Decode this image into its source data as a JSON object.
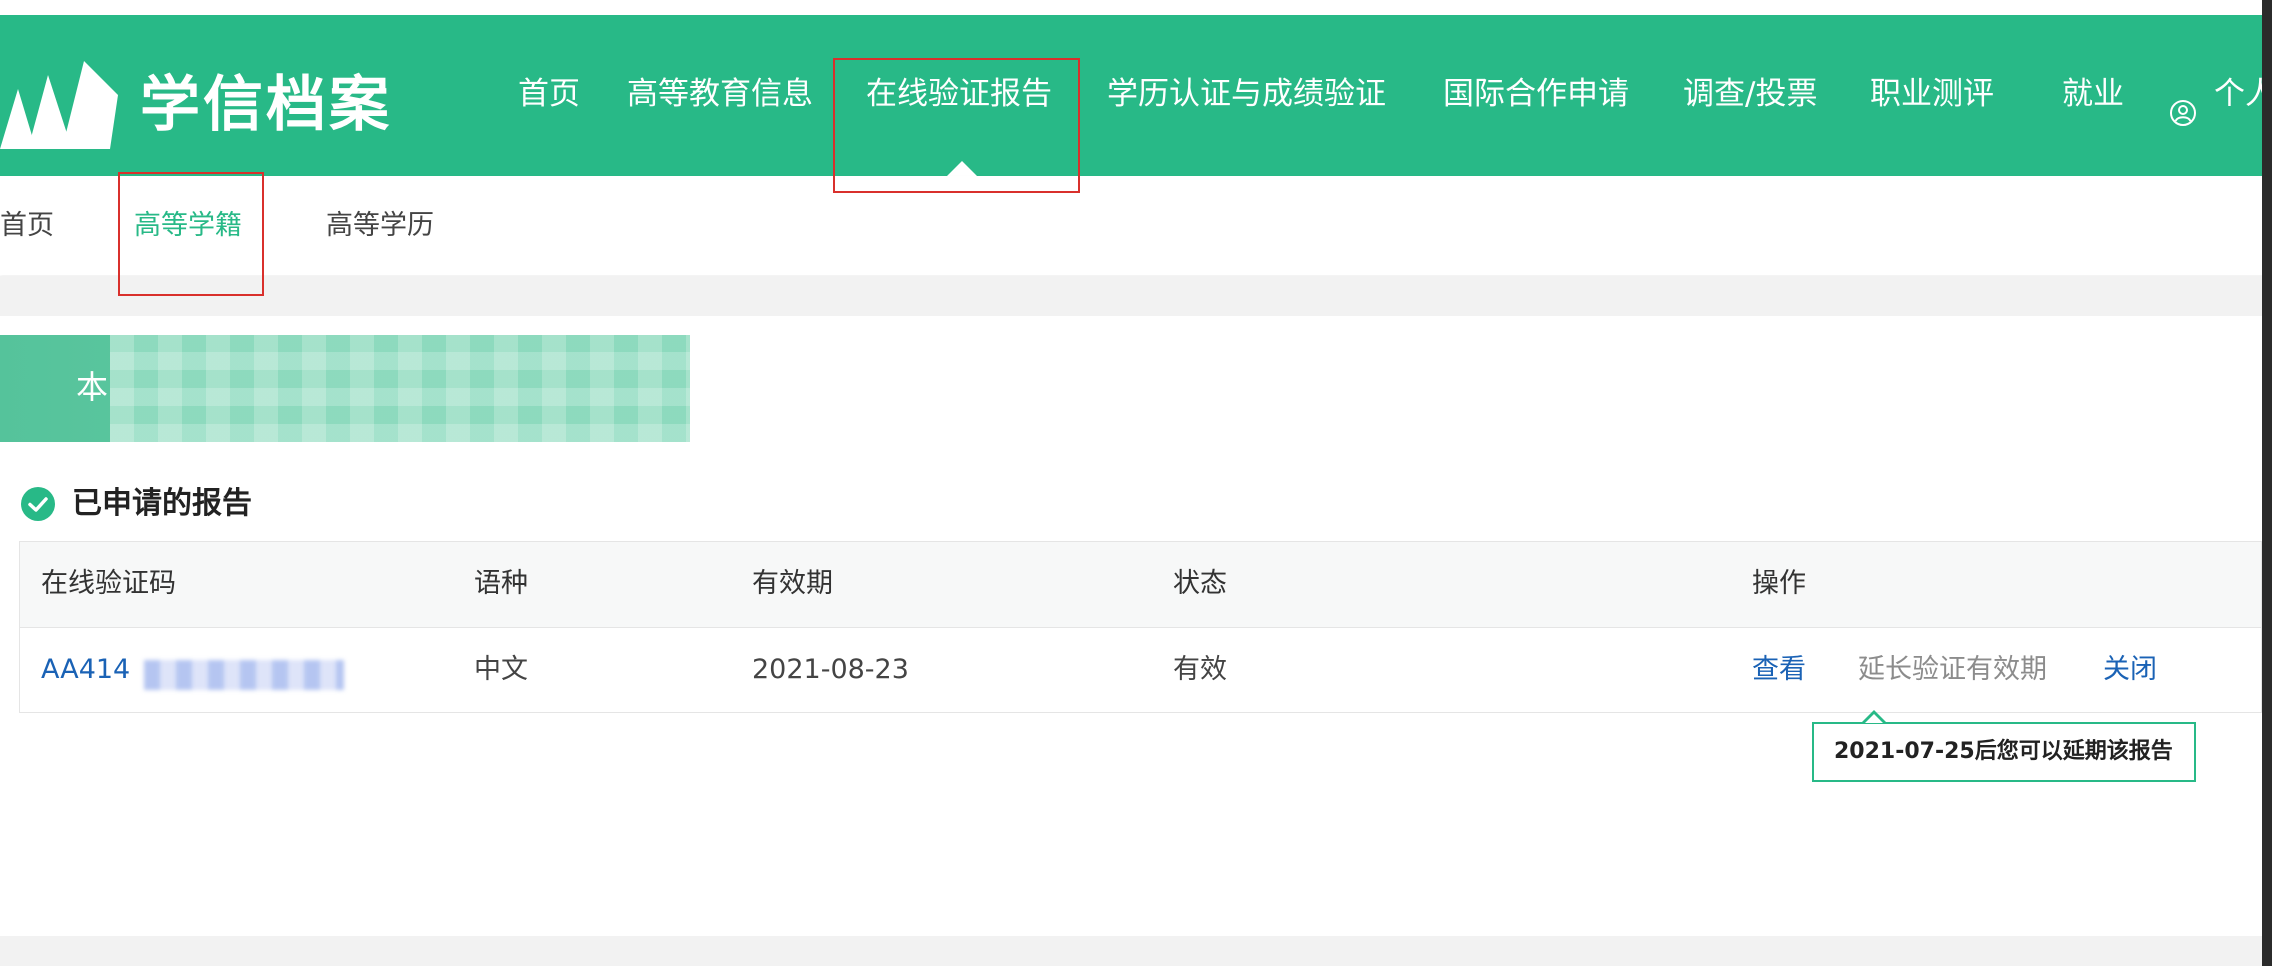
{
  "brand": {
    "name": "学信档案",
    "green": "#28b987",
    "link_blue": "#1a62b5",
    "highlight_red": "#d9302c"
  },
  "header": {
    "nav": [
      {
        "label": "首页"
      },
      {
        "label": "高等教育信息"
      },
      {
        "label": "在线验证报告",
        "active": true
      },
      {
        "label": "学历认证与成绩验证"
      },
      {
        "label": "国际合作申请"
      },
      {
        "label": "调查/投票"
      },
      {
        "label": "职业测评"
      },
      {
        "label": "就业"
      }
    ],
    "user_label": "个人",
    "user_icon": "user-circle-icon"
  },
  "subnav": {
    "items": [
      {
        "label": "首页"
      },
      {
        "label": "高等学籍",
        "active": true
      },
      {
        "label": "高等学历"
      }
    ]
  },
  "banner": {
    "text": "本"
  },
  "section": {
    "title": "已申请的报告",
    "icon": "check-circle-icon"
  },
  "table": {
    "columns": [
      "在线验证码",
      "语种",
      "有效期",
      "状态",
      "操作"
    ],
    "rows": [
      {
        "code": "AA414",
        "language": "中文",
        "expiry": "2021-08-23",
        "status": "有效",
        "actions": {
          "view": "查看",
          "extend": "延长验证有效期",
          "close": "关闭"
        }
      }
    ]
  },
  "tooltip": {
    "text": "2021-07-25后您可以延期该报告"
  }
}
